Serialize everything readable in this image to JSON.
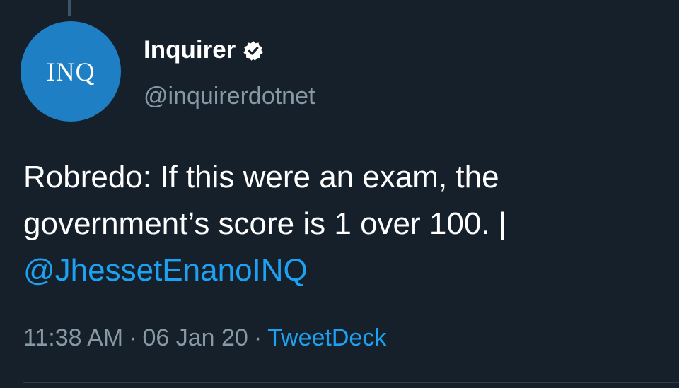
{
  "author": {
    "avatar_text": "INQ",
    "display_name": "Inquirer",
    "handle": "@inquirerdotnet",
    "verified_icon": "verified-badge-icon"
  },
  "tweet": {
    "line1": "Robredo: If this were an exam, the",
    "line2": "government’s score is 1 over 100. |",
    "mention": "@JhessetEnanoINQ"
  },
  "meta": {
    "time": "11:38 AM",
    "separator": "·",
    "date": "06 Jan 20",
    "source": "TweetDeck"
  },
  "colors": {
    "background": "#15202b",
    "avatar": "#1f7fc4",
    "link": "#1da1f2",
    "muted": "#8899a6"
  }
}
